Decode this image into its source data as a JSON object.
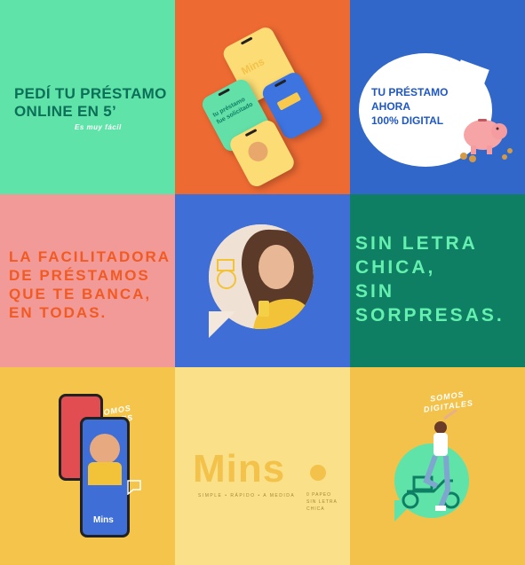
{
  "tiles": {
    "t1": {
      "headline_line1": "PEDÍ TU PRÉSTAMO",
      "headline_line2": "ONLINE EN 5’",
      "subline": "Es muy fácil"
    },
    "t2": {
      "phone_brand": "Mins",
      "phone_badge_line1": "tu préstamo",
      "phone_badge_line2": "fue solicitado"
    },
    "t3": {
      "line1": "TU PRÉSTAMO",
      "line2": "AHORA",
      "line3": "100% DIGITAL"
    },
    "t4": {
      "line1": "LA FACILITADORA",
      "line2": "DE PRÉSTAMOS",
      "line3": "QUE TE BANCA,",
      "line4": "EN TODAS."
    },
    "t6": {
      "line1": "SIN LETRA",
      "line2": "CHICA,",
      "line3": "SIN",
      "line4": "SORPRESAS."
    },
    "t7": {
      "tag_line1": "SOMOS",
      "tag_line2": "ÁGILES",
      "phone_brand": "Mins"
    },
    "t8": {
      "logo": "Mins",
      "tagline": "SIMPLE • RÁPIDO • A MEDIDA",
      "side_line1": "0 PAPEO",
      "side_line2": "SIN LETRA",
      "side_line3": "CHICA"
    },
    "t9": {
      "tag_line1": "SOMOS",
      "tag_line2": "DIGITALES"
    }
  },
  "colors": {
    "mint": "#5fe3a9",
    "orange": "#ee6a33",
    "blue": "#3067c8",
    "pink": "#f29a97",
    "royal": "#3f6fd6",
    "green": "#0f7f64",
    "yellow": "#f4c54a"
  }
}
